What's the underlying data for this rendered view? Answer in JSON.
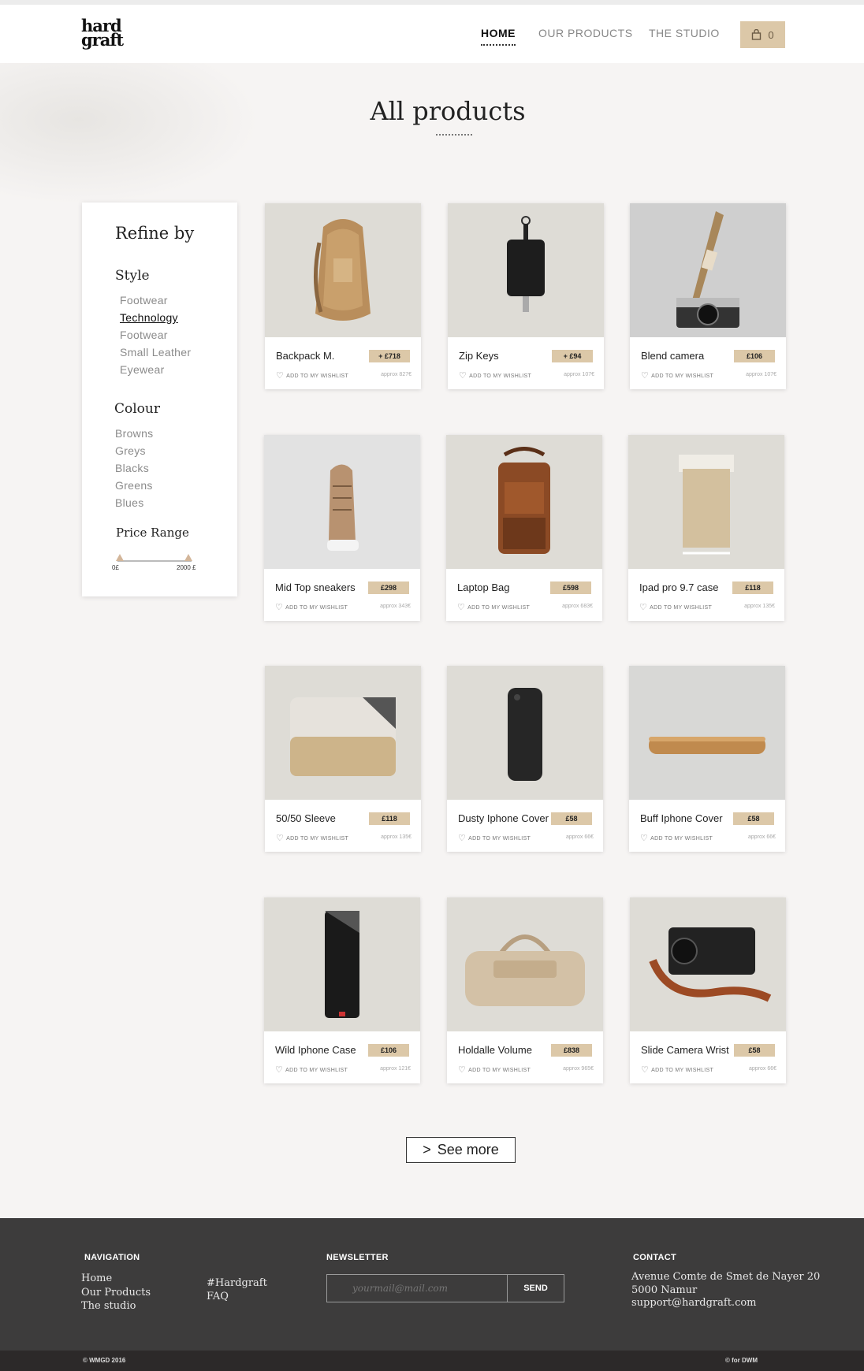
{
  "header": {
    "logo_line1": "hard",
    "logo_line2": "graft",
    "nav": [
      "HOME",
      "OUR PRODUCTS",
      "THE STUDIO"
    ],
    "cart_count": "0"
  },
  "page_title": "All products",
  "sidebar": {
    "title": "Refine by",
    "style_heading": "Style",
    "style_items": [
      "Footwear",
      "Technology",
      "Footwear",
      "Small Leather",
      "Eyewear"
    ],
    "colour_heading": "Colour",
    "colour_items": [
      "Browns",
      "Greys",
      "Blacks",
      "Greens",
      "Blues"
    ],
    "price_heading": "Price Range",
    "price_min": "0£",
    "price_max": "2000 £"
  },
  "wishlist_label": "ADD TO MY WISHLIST",
  "products": [
    {
      "name": "Backpack M.",
      "price": "+ £718",
      "approx": "approx 827€"
    },
    {
      "name": "Zip Keys",
      "price": "+ £94",
      "approx": "approx 107€"
    },
    {
      "name": "Blend camera",
      "price": "£106",
      "approx": "approx 107€"
    },
    {
      "name": "Mid Top sneakers",
      "price": "£298",
      "approx": "approx 343€"
    },
    {
      "name": "Laptop Bag",
      "price": "£598",
      "approx": "approx 683€"
    },
    {
      "name": "Ipad pro 9.7 case",
      "price": "£118",
      "approx": "approx 135€"
    },
    {
      "name": "50/50 Sleeve",
      "price": "£118",
      "approx": "approx 135€"
    },
    {
      "name": "Dusty Iphone Cover",
      "price": "£58",
      "approx": "approx 66€"
    },
    {
      "name": "Buff Iphone Cover",
      "price": "£58",
      "approx": "approx 66€"
    },
    {
      "name": "Wild Iphone Case",
      "price": "£106",
      "approx": "approx 121€"
    },
    {
      "name": "Holdalle Volume",
      "price": "£838",
      "approx": "approx 965€"
    },
    {
      "name": "Slide Camera Wrist",
      "price": "£58",
      "approx": "approx 66€"
    }
  ],
  "see_more": "See more",
  "footer": {
    "nav_heading": "NAVIGATION",
    "nav_links": [
      "Home",
      "Our Products",
      "The studio"
    ],
    "extra_links": [
      "#Hardgraft",
      "FAQ"
    ],
    "newsletter_heading": "NEWSLETTER",
    "newsletter_placeholder": "yourmail@mail.com",
    "send_label": "SEND",
    "contact_heading": "CONTACT",
    "contact_lines": [
      "Avenue Comte de Smet de Nayer 20",
      "5000 Namur",
      "support@hardgraft.com"
    ],
    "copyright": "© WMGD 2016",
    "credit": "© for DWM"
  },
  "colors": {
    "accent": "#dcc8a8",
    "footer": "#3d3c3c",
    "background": "#f6f4f3"
  }
}
